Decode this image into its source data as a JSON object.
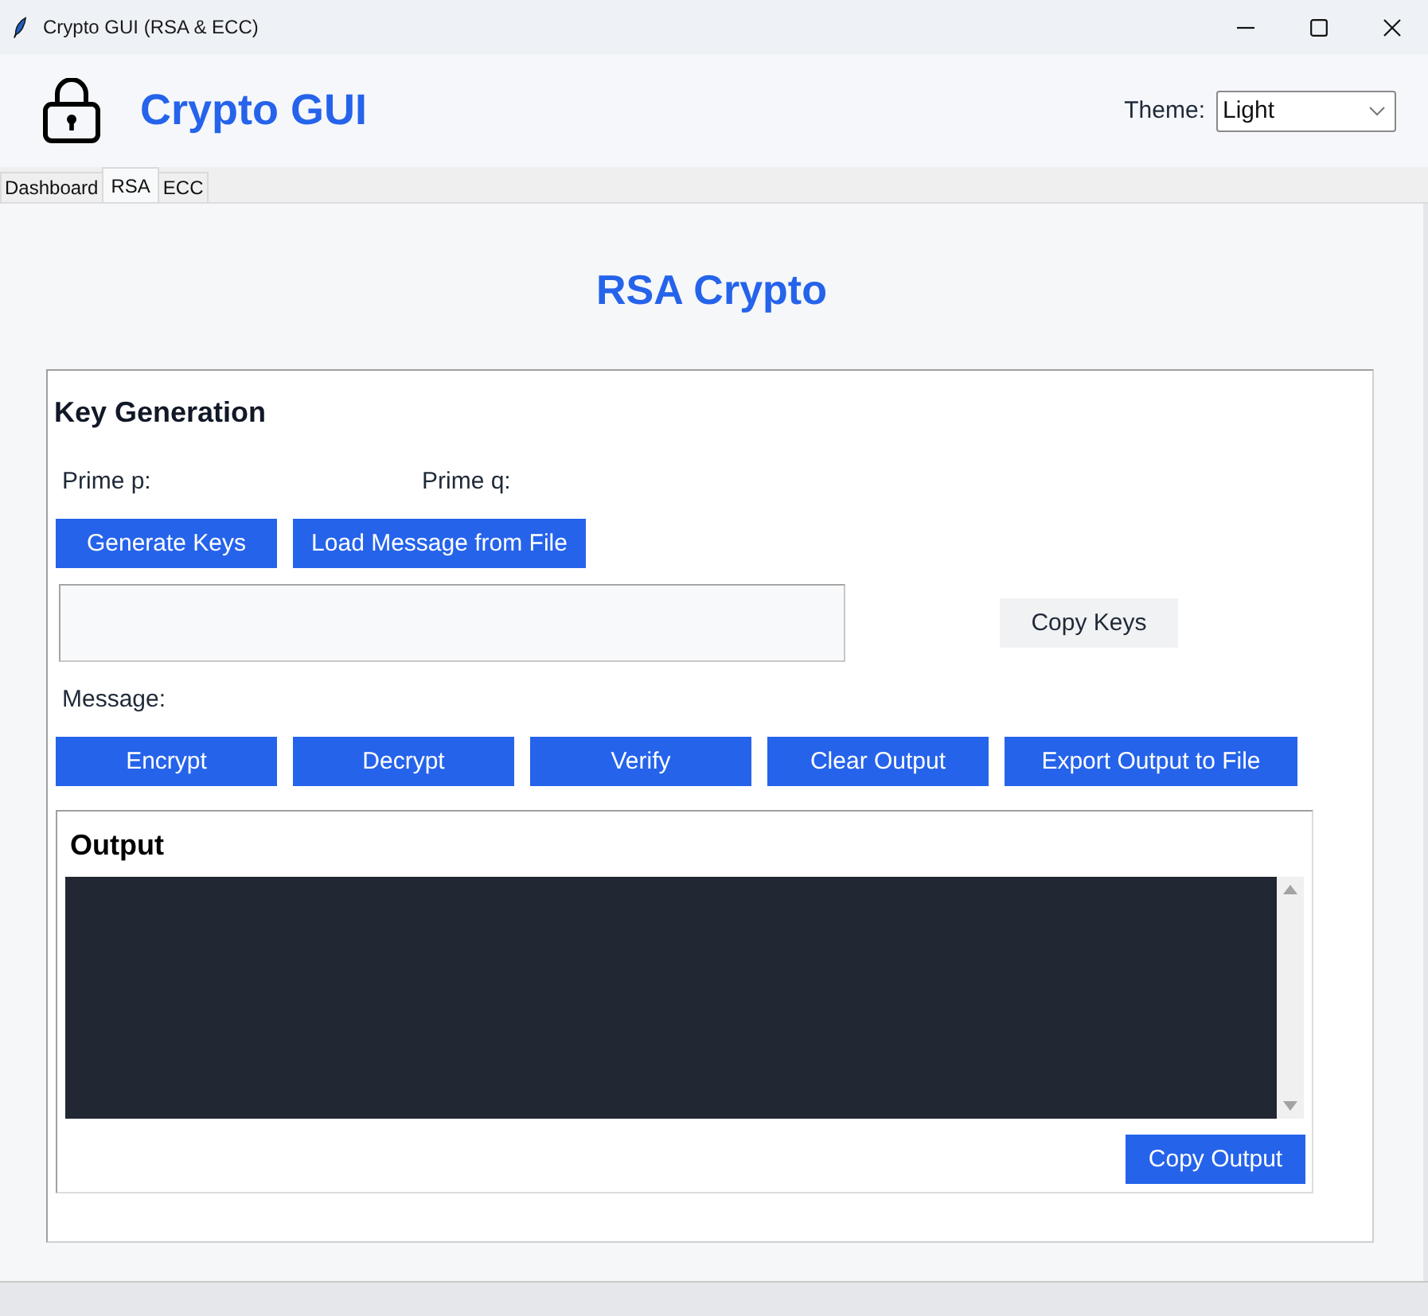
{
  "window": {
    "title": "Crypto GUI (RSA & ECC)"
  },
  "header": {
    "title": "Crypto GUI",
    "theme_label": "Theme:",
    "theme_select": {
      "value": "Light"
    }
  },
  "tabs": [
    {
      "label": "Dashboard",
      "selected": false
    },
    {
      "label": "RSA",
      "selected": true
    },
    {
      "label": "ECC",
      "selected": false
    }
  ],
  "page": {
    "heading": "RSA Crypto"
  },
  "key_generation": {
    "title": "Key Generation",
    "prime_labels": [
      "Prime p:",
      "Prime q:"
    ],
    "buttons": [
      "Generate Keys",
      "Load Message from File"
    ],
    "copy_button": "Copy Keys",
    "message_label": "Message:",
    "actions": [
      "Encrypt",
      "Decrypt",
      "Verify",
      "Clear Output",
      "Export Output to File"
    ]
  },
  "output": {
    "title": "Output",
    "copy_button": "Copy Output"
  }
}
